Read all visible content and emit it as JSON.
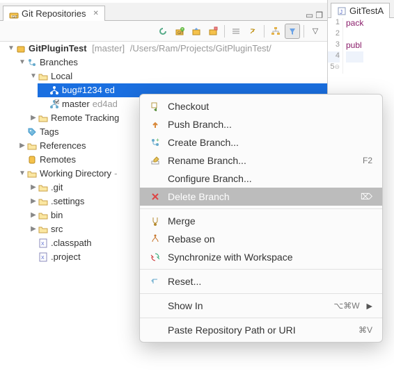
{
  "tabs": {
    "repo_view_title": "Git Repositories",
    "editor_tab_title": "GitTestA"
  },
  "repo": {
    "name": "GitPluginTest",
    "current_branch": "master",
    "path_suffix": "/Users/Ram/Projects/GitPluginTest/"
  },
  "tree": {
    "branches": "Branches",
    "local": "Local",
    "bugbranch": "bug#1234 ed",
    "master": "master",
    "master_sha": "ed4ad",
    "remote_tracking": "Remote Tracking",
    "tags": "Tags",
    "references": "References",
    "remotes": "Remotes",
    "working_dir": "Working Directory",
    "dot_git": ".git",
    "dot_settings": ".settings",
    "bin": "bin",
    "src": "src",
    "classpath": ".classpath",
    "project": ".project"
  },
  "ctx": {
    "checkout": "Checkout",
    "push": "Push Branch...",
    "create": "Create Branch...",
    "rename": "Rename Branch...",
    "rename_key": "F2",
    "configure": "Configure Branch...",
    "delete": "Delete Branch",
    "delete_key": "⌦",
    "merge": "Merge",
    "rebase": "Rebase on",
    "sync": "Synchronize with Workspace",
    "reset": "Reset...",
    "showin": "Show In",
    "showin_key": "⌥⌘W",
    "paste": "Paste Repository Path or URI",
    "paste_key": "⌘V"
  },
  "code": {
    "l1": "pack",
    "l3": "publ"
  }
}
